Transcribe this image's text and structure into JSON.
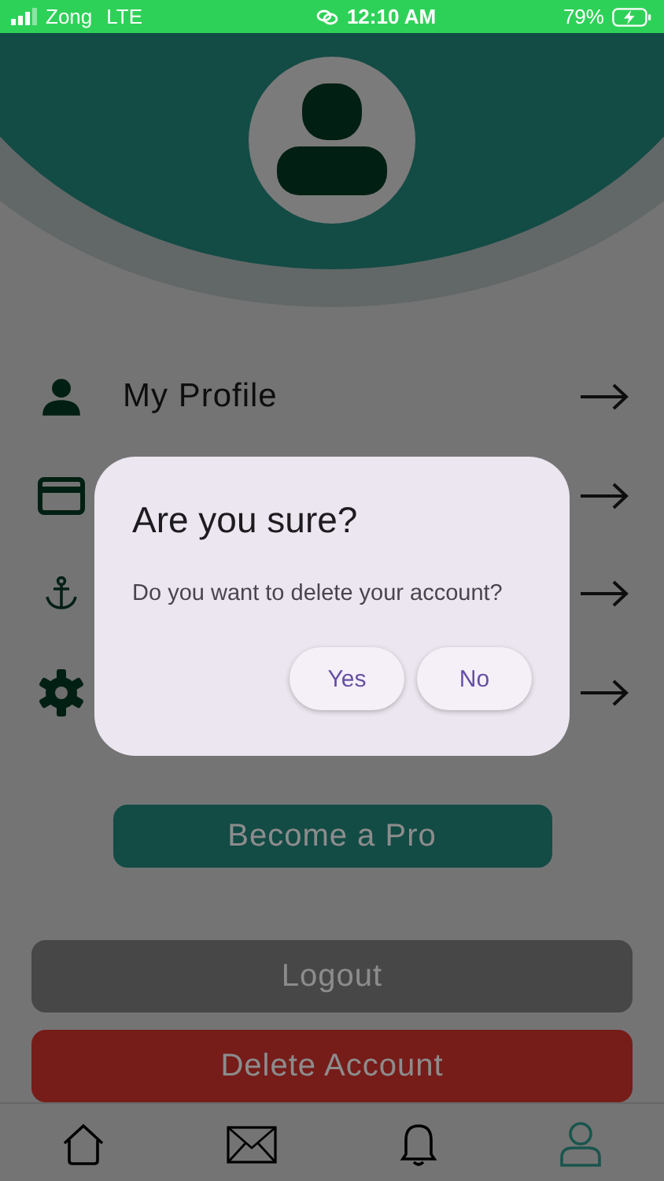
{
  "status_bar": {
    "carrier": "Zong",
    "network": "LTE",
    "time": "12:10 AM",
    "battery": "79%"
  },
  "menu": [
    {
      "kind": "person",
      "label": "My Profile"
    },
    {
      "kind": "card"
    },
    {
      "kind": "anchor"
    },
    {
      "kind": "gear"
    }
  ],
  "pro_button": "Become a Pro",
  "logout_button": "Logout",
  "delete_button": "Delete Account",
  "nav": [
    {
      "kind": "home",
      "selected": false
    },
    {
      "kind": "mail",
      "selected": false
    },
    {
      "kind": "bell",
      "selected": false
    },
    {
      "kind": "user",
      "selected": true
    }
  ],
  "dialog": {
    "title": "Are you sure?",
    "message": "Do you want to delete your account?",
    "buttons": [
      "Yes",
      "No"
    ]
  }
}
